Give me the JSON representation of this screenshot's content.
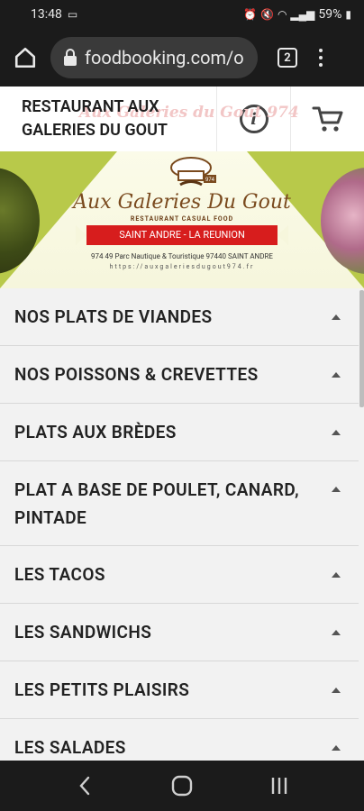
{
  "status_bar": {
    "time": "13:48",
    "battery": "59%"
  },
  "browser": {
    "url": "foodbooking.com/o",
    "tab_count": "2"
  },
  "site": {
    "title_line1": "RESTAURANT AUX",
    "title_line2": "GALERIES DU GOUT",
    "title_watermark": "Aux Galeries du Gout 974"
  },
  "banner": {
    "badge": "974",
    "logo_script": "Aux Galeries Du Gout",
    "logo_sub": "RESTAURANT CASUAL FOOD",
    "ribbon": "SAINT ANDRE - LA REUNION",
    "address": "974 49 Parc Nautique & Touristique 97440 SAINT ANDRE",
    "website": "https://auxgaleriesdugout974.fr"
  },
  "categories": [
    {
      "label": "NOS PLATS DE VIANDES"
    },
    {
      "label": "NOS POISSONS & CREVETTES"
    },
    {
      "label": "PLATS AUX BRÈDES"
    },
    {
      "label": "PLAT A BASE DE POULET, CANARD, PINTADE"
    },
    {
      "label": "LES TACOS"
    },
    {
      "label": "LES SANDWICHS"
    },
    {
      "label": "LES PETITS PLAISIRS"
    },
    {
      "label": "LES SALADES"
    }
  ]
}
